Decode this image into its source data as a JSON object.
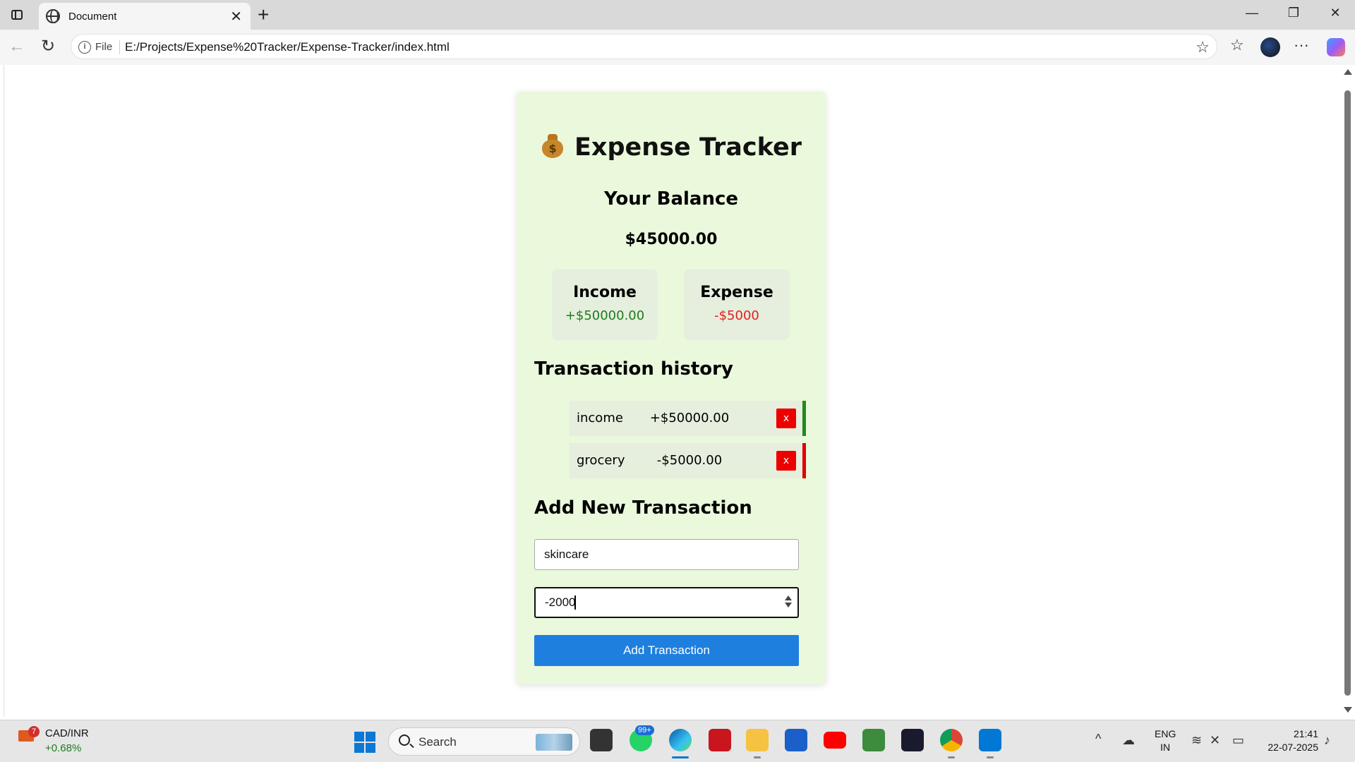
{
  "browser": {
    "tab_title": "Document",
    "tab_close": "✕",
    "new_tab": "+",
    "file_label": "File",
    "url": "E:/Projects/Expense%20Tracker/Expense-Tracker/index.html",
    "window_minimize": "—",
    "window_restore": "❐",
    "window_close": "✕"
  },
  "app": {
    "title": "Expense Tracker",
    "balance_label": "Your Balance",
    "balance_value": "$45000.00",
    "income_label": "Income",
    "income_value": "+$50000.00",
    "expense_label": "Expense",
    "expense_value": "-$5000",
    "history_title": "Transaction history",
    "transactions": [
      {
        "name": "income",
        "amount": "+$50000.00",
        "delete_label": "x",
        "type": "income",
        "color": "#1f8a1f"
      },
      {
        "name": "grocery",
        "amount": "-$5000.00",
        "delete_label": "x",
        "type": "expense",
        "color": "#e00000"
      }
    ],
    "add_title": "Add New Transaction",
    "text_input_value": "skincare",
    "amount_input_value": "-2000",
    "add_button_label": "Add Transaction",
    "colors": {
      "card_bg": "#eaf8dc",
      "income_green": "#1f7a1f",
      "expense_red": "#e02020",
      "delete_red": "#ee0000",
      "button_blue": "#1e7fdf"
    }
  },
  "taskbar": {
    "ticker_badge": "7",
    "ticker_name": "CAD/INR",
    "ticker_change": "+0.68%",
    "search_label": "Search",
    "whatsapp_badge": "99+",
    "lang_top": "ENG",
    "lang_bottom": "IN",
    "time": "21:41",
    "date": "22-07-2025"
  }
}
